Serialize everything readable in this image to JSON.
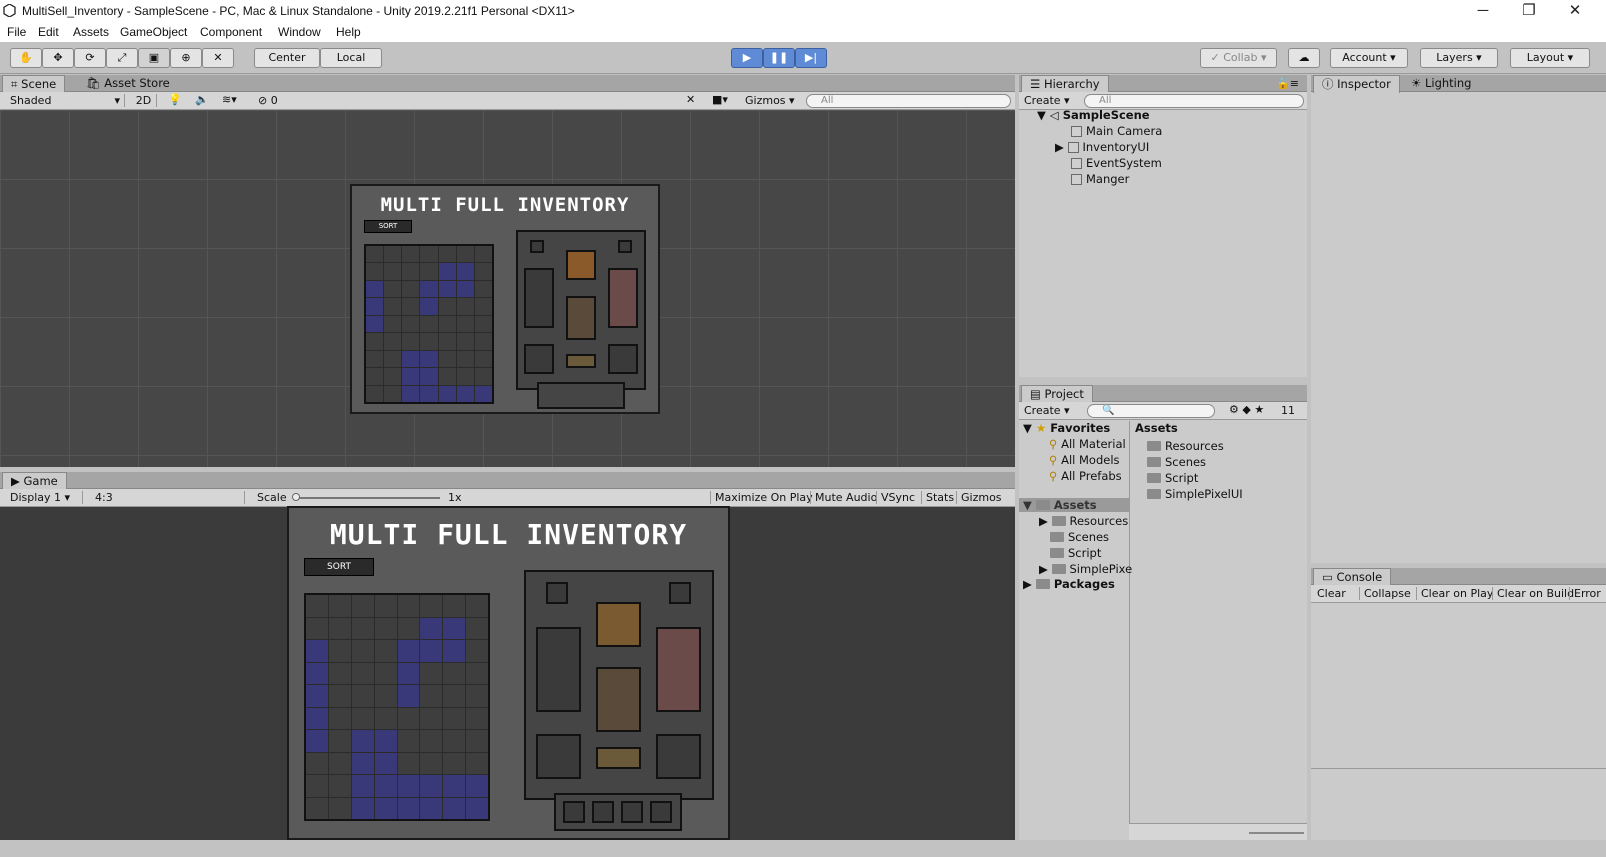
{
  "window": {
    "title": "MultiSell_Inventory - SampleScene - PC, Mac & Linux Standalone - Unity 2019.2.21f1 Personal <DX11>",
    "min": "─",
    "max": "❐",
    "close": "✕"
  },
  "menu": [
    "File",
    "Edit",
    "Assets",
    "GameObject",
    "Component",
    "Window",
    "Help"
  ],
  "toolbar": {
    "center": "Center",
    "local": "Local",
    "collab": "Collab",
    "account": "Account",
    "layers": "Layers",
    "layout": "Layout"
  },
  "scene": {
    "tab": "Scene",
    "tab2": "Asset Store",
    "shading": "Shaded",
    "mode2d": "2D",
    "gizmos": "Gizmos",
    "search": "All",
    "count": "0"
  },
  "game": {
    "tab": "Game",
    "display": "Display 1",
    "aspect": "4:3",
    "scale_label": "Scale",
    "scale_value": "1x",
    "maximize": "Maximize On Play",
    "mute": "Mute Audio",
    "vsync": "VSync",
    "stats": "Stats",
    "gizmos": "Gizmos"
  },
  "inventory": {
    "title": "MULTI FULL INVENTORY",
    "sort": "SORT"
  },
  "hierarchy": {
    "tab": "Hierarchy",
    "create": "Create",
    "search": "All",
    "scene": "SampleScene",
    "items": [
      "Main Camera",
      "InventoryUI",
      "EventSystem",
      "Manger"
    ]
  },
  "inspector": {
    "tab": "Inspector",
    "tab2": "Lighting"
  },
  "project": {
    "tab": "Project",
    "create": "Create",
    "count": "11",
    "favorites": "Favorites",
    "fav_items": [
      "All Material",
      "All Models",
      "All Prefabs"
    ],
    "assets": "Assets",
    "asset_tree": [
      "Resources",
      "Scenes",
      "Script",
      "SimplePixe"
    ],
    "packages": "Packages",
    "assets_header": "Assets",
    "asset_list": [
      "Resources",
      "Scenes",
      "Script",
      "SimplePixelUI"
    ]
  },
  "console": {
    "tab": "Console",
    "buttons": [
      "Clear",
      "Collapse",
      "Clear on Play",
      "Clear on Build",
      "Error"
    ]
  }
}
